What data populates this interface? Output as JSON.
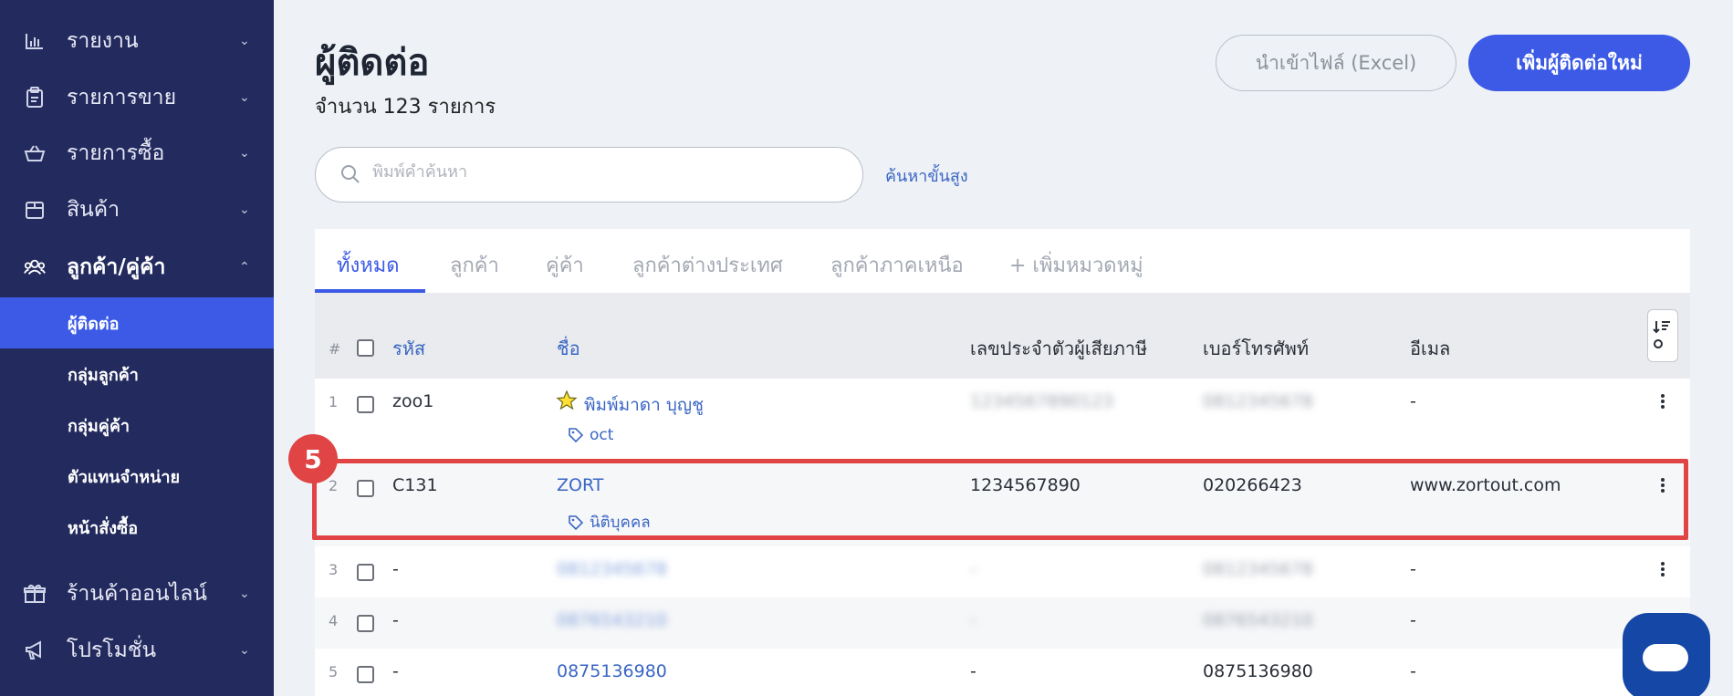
{
  "sidebar": {
    "items": [
      {
        "label": "รายงาน",
        "icon": "bar-chart-icon",
        "chevron": "⌄"
      },
      {
        "label": "รายการขาย",
        "icon": "clipboard-icon",
        "chevron": "⌄"
      },
      {
        "label": "รายการซื้อ",
        "icon": "basket-icon",
        "chevron": "⌄"
      },
      {
        "label": "สินค้า",
        "icon": "box-icon",
        "chevron": "⌄"
      },
      {
        "label": "ลูกค้า/คู่ค้า",
        "icon": "users-icon",
        "chevron": "⌃"
      },
      {
        "label": "ร้านค้าออนไลน์",
        "icon": "gift-icon",
        "chevron": "⌄"
      },
      {
        "label": "โปรโมชั่น",
        "icon": "megaphone-icon",
        "chevron": "⌄"
      }
    ],
    "sub_items": [
      {
        "label": "ผู้ติดต่อ"
      },
      {
        "label": "กลุ่มลูกค้า"
      },
      {
        "label": "กลุ่มคู่ค้า"
      },
      {
        "label": "ตัวแทนจำหน่าย"
      },
      {
        "label": "หน้าสั่งซื้อ"
      }
    ]
  },
  "header": {
    "title": "ผู้ติดต่อ",
    "count": "จำนวน 123 รายการ",
    "import_label": "นำเข้าไฟล์ (Excel)",
    "add_label": "เพิ่มผู้ติดต่อใหม่"
  },
  "search": {
    "placeholder": "พิมพ์คำค้นหา",
    "advanced_label": "ค้นหาขั้นสูง"
  },
  "tabs": [
    {
      "label": "ทั้งหมด"
    },
    {
      "label": "ลูกค้า"
    },
    {
      "label": "คู่ค้า"
    },
    {
      "label": "ลูกค้าต่างประเทศ"
    },
    {
      "label": "ลูกค้าภาคเหนือ"
    },
    {
      "label": "+ เพิ่มหมวดหมู่"
    }
  ],
  "table": {
    "headers": {
      "hash": "#",
      "code": "รหัส",
      "name": "ชื่อ",
      "tax_id": "เลขประจำตัวผู้เสียภาษี",
      "phone": "เบอร์โทรศัพท์",
      "email": "อีเมล"
    },
    "rows": [
      {
        "num": "1",
        "code": "zoo1",
        "name": "พิมพ์มาดา บุญชู",
        "tag": "oct",
        "tax_id": "1234567890123",
        "phone": "0812345678",
        "email": "-",
        "starred": true
      },
      {
        "num": "2",
        "code": "C131",
        "name": "ZORT",
        "tag": "นิติบุคคล",
        "tax_id": "1234567890",
        "phone": "020266423",
        "email": "www.zortout.com",
        "starred": false
      },
      {
        "num": "3",
        "code": "-",
        "name": "0812345678",
        "tax_id": "-",
        "phone": "0812345678",
        "email": "-"
      },
      {
        "num": "4",
        "code": "-",
        "name": "0876543210",
        "tax_id": "-",
        "phone": "0876543210",
        "email": "-"
      },
      {
        "num": "5",
        "code": "-",
        "name": "0875136980",
        "tax_id": "-",
        "phone": "0875136980",
        "email": "-"
      }
    ]
  },
  "annotation": {
    "step": "5"
  },
  "colors": {
    "sidebar": "#232b5e",
    "accent": "#3c5ae6",
    "highlight": "#e04444",
    "link": "#3a66c4"
  }
}
